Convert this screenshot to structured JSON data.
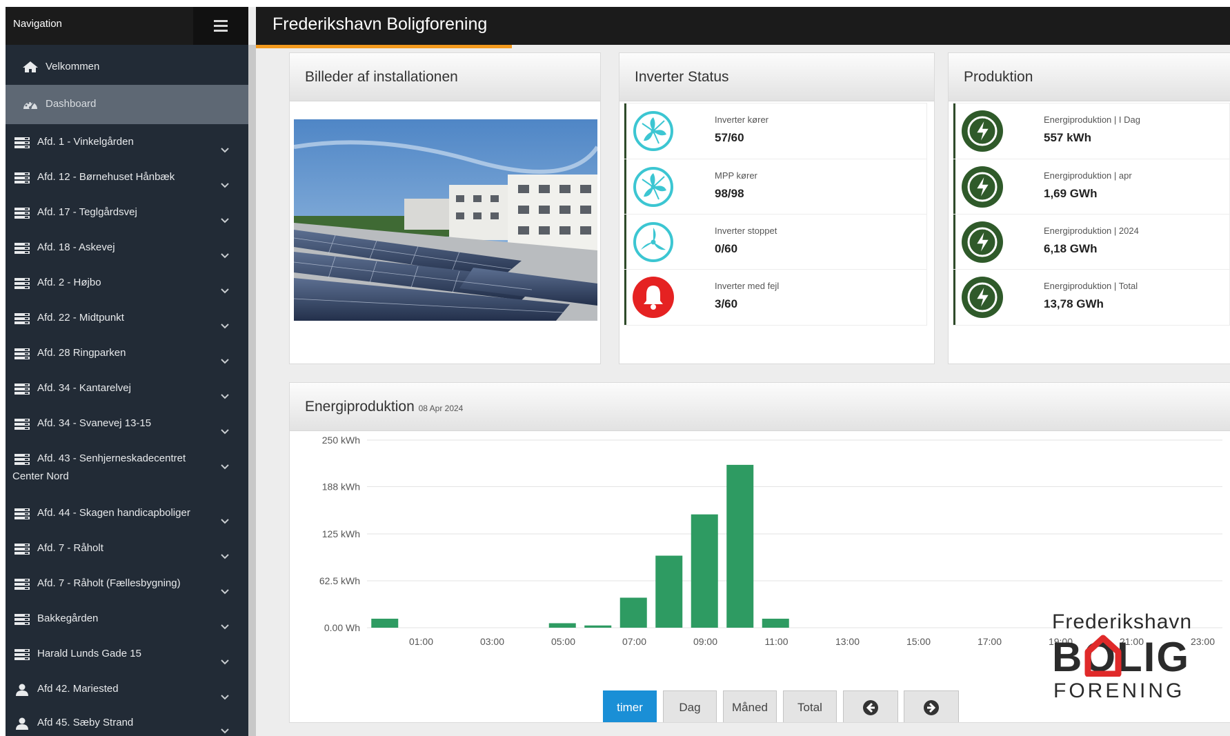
{
  "sidebar": {
    "title": "Navigation",
    "welcome": "Velkommen",
    "dashboard": "Dashboard",
    "items": [
      {
        "label": "Afd. 1 - Vinkelgården",
        "icon": "server-icon"
      },
      {
        "label": "Afd. 12 - Børnehuset Hånbæk",
        "icon": "server-icon"
      },
      {
        "label": "Afd. 17 - Teglgårdsvej",
        "icon": "server-icon"
      },
      {
        "label": "Afd. 18 - Askevej",
        "icon": "server-icon"
      },
      {
        "label": "Afd. 2 - Højbo",
        "icon": "server-icon"
      },
      {
        "label": "Afd. 22 - Midtpunkt",
        "icon": "server-icon"
      },
      {
        "label": "Afd. 28 Ringparken",
        "icon": "server-icon"
      },
      {
        "label": "Afd. 34 - Kantarelvej",
        "icon": "server-icon"
      },
      {
        "label": "Afd. 34 - Svanevej 13-15",
        "icon": "server-icon"
      },
      {
        "label": "Afd. 43 - Senhjerneskadecentret Center Nord",
        "icon": "server-icon"
      },
      {
        "label": "Afd. 44 - Skagen handicapboliger",
        "icon": "server-icon"
      },
      {
        "label": "Afd. 7 - Råholt",
        "icon": "server-icon"
      },
      {
        "label": "Afd. 7 - Råholt (Fællesbygning)",
        "icon": "server-icon"
      },
      {
        "label": "Bakkegården",
        "icon": "server-icon"
      },
      {
        "label": "Harald Lunds Gade 15",
        "icon": "server-icon"
      },
      {
        "label": "Afd 42. Mariested",
        "icon": "user-icon"
      },
      {
        "label": "Afd 45. Sæby Strand",
        "icon": "user-icon"
      }
    ]
  },
  "header": {
    "title": "Frederikshavn Boligforening"
  },
  "images_panel": {
    "title": "Billeder af installationen"
  },
  "inverter_panel": {
    "title": "Inverter Status",
    "stats": [
      {
        "label": "Inverter kører",
        "value": "57/60",
        "icon": "fan-icon",
        "color": "#3cc6d2"
      },
      {
        "label": "MPP kører",
        "value": "98/98",
        "icon": "fan-icon",
        "color": "#3cc6d2"
      },
      {
        "label": "Inverter stoppet",
        "value": "0/60",
        "icon": "fan-stopped-icon",
        "color": "#3cc6d2"
      },
      {
        "label": "Inverter med fejl",
        "value": "3/60",
        "icon": "bell-icon",
        "color": "#e52222"
      }
    ]
  },
  "production_panel": {
    "title": "Produktion",
    "stats": [
      {
        "label": "Energiproduktion | I Dag",
        "value": "557 kWh",
        "icon": "bolt-icon"
      },
      {
        "label": "Energiproduktion | apr",
        "value": "1,69 GWh",
        "icon": "bolt-icon"
      },
      {
        "label": "Energiproduktion | 2024",
        "value": "6,18 GWh",
        "icon": "bolt-icon"
      },
      {
        "label": "Energiproduktion | Total",
        "value": "13,78 GWh",
        "icon": "bolt-icon"
      }
    ]
  },
  "energy_panel": {
    "title": "Energiproduktion",
    "date": "08 Apr 2024",
    "buttons": {
      "hours": "timer",
      "day": "Dag",
      "month": "Måned",
      "total": "Total"
    }
  },
  "chart_data": {
    "type": "bar",
    "title": "",
    "xlabel": "",
    "ylabel": "",
    "ylim": [
      0,
      250
    ],
    "y_ticks": [
      "250 kWh",
      "188 kWh",
      "125 kWh",
      "62.5 kWh",
      "0.00 Wh"
    ],
    "y_tick_values": [
      250,
      188,
      125,
      62.5,
      0
    ],
    "x_ticks": [
      "01:00",
      "03:00",
      "05:00",
      "07:00",
      "09:00",
      "11:00",
      "13:00",
      "15:00",
      "17:00",
      "19:00",
      "21:00",
      "23:00"
    ],
    "x_tick_values": [
      1,
      3,
      5,
      7,
      9,
      11,
      13,
      15,
      17,
      19,
      21,
      23
    ],
    "x": [
      0,
      1,
      2,
      3,
      4,
      5,
      6,
      7,
      8,
      9,
      10,
      11,
      12,
      13,
      14,
      15,
      16,
      17,
      18,
      19,
      20,
      21,
      22,
      23
    ],
    "values": [
      12,
      0,
      0,
      0,
      0,
      6,
      3,
      40,
      96,
      151,
      217,
      12,
      0,
      0,
      0,
      0,
      0,
      0,
      0,
      0,
      0,
      0,
      0,
      0
    ],
    "bar_color": "#2e9b62",
    "grid": true,
    "legend": "none"
  },
  "logo": {
    "top": "Frederikshavn",
    "middle": "BOLIG",
    "bottom": "FORENING"
  },
  "colors": {
    "accent": "#f39a1e",
    "primary_button": "#1a8fd6",
    "bolt": "#2f5a2a"
  }
}
